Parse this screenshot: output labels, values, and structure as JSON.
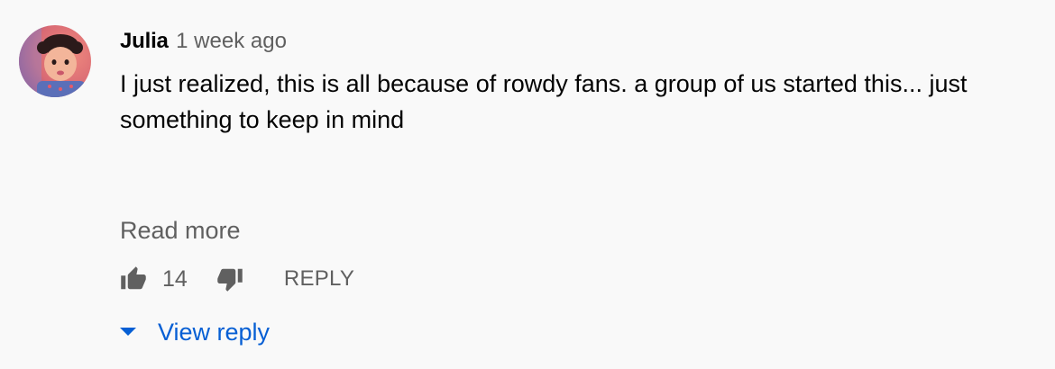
{
  "comment": {
    "author": "Julia",
    "timestamp": "1 week ago",
    "text": "I just realized, this is all because of rowdy fans. a group of us started this... just something to keep in mind",
    "read_more_label": "Read more",
    "like_count": "14",
    "reply_label": "REPLY",
    "view_reply_label": "View reply",
    "icons": {
      "like": "thumb-up-icon",
      "dislike": "thumb-down-icon",
      "expand": "caret-down-icon"
    }
  },
  "colors": {
    "background": "#f9f9f9",
    "text_primary": "#030303",
    "text_secondary": "#606060",
    "link_blue": "#065fd4"
  }
}
